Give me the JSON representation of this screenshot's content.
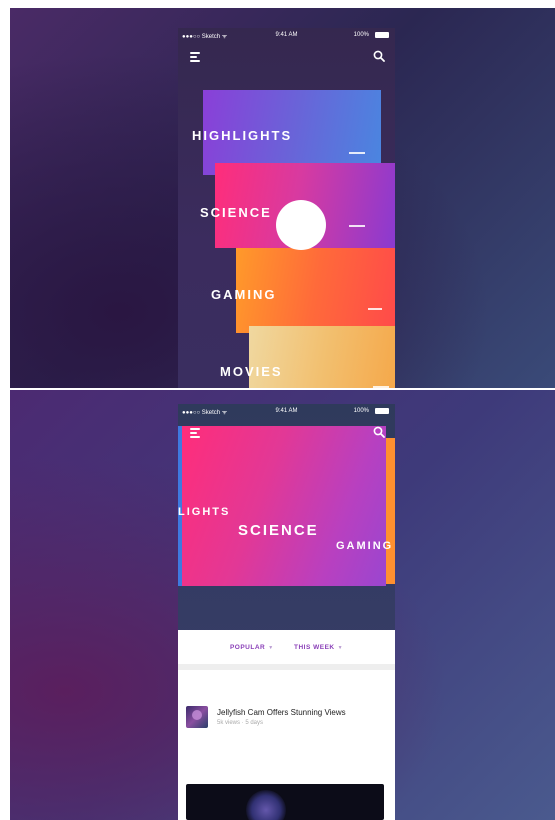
{
  "status_bar": {
    "carrier": "●●●○○ Sketch ᯤ",
    "time": "9:41 AM",
    "battery": "100%"
  },
  "categories": [
    {
      "label": "HIGHLIGHTS",
      "color": "#6a63d8"
    },
    {
      "label": "SCIENCE",
      "color": "#e23896"
    },
    {
      "label": "GAMING",
      "color": "#ff6a3a"
    },
    {
      "label": "MOVIES",
      "color": "#f2c070"
    }
  ],
  "expanded_view": {
    "left_peek_label": "LIGHTS",
    "selected_label": "SCIENCE",
    "right_peek_label": "GAMING",
    "filters": [
      {
        "label": "POPULAR"
      },
      {
        "label": "THIS WEEK"
      }
    ]
  },
  "feed": [
    {
      "title": "Jellyfish Cam Offers Stunning Views",
      "meta": "5k views · 5 days"
    }
  ],
  "icons": {
    "menu": "hamburger-menu-icon",
    "search": "search-icon",
    "filter_chevron": "chevron-down-icon"
  }
}
